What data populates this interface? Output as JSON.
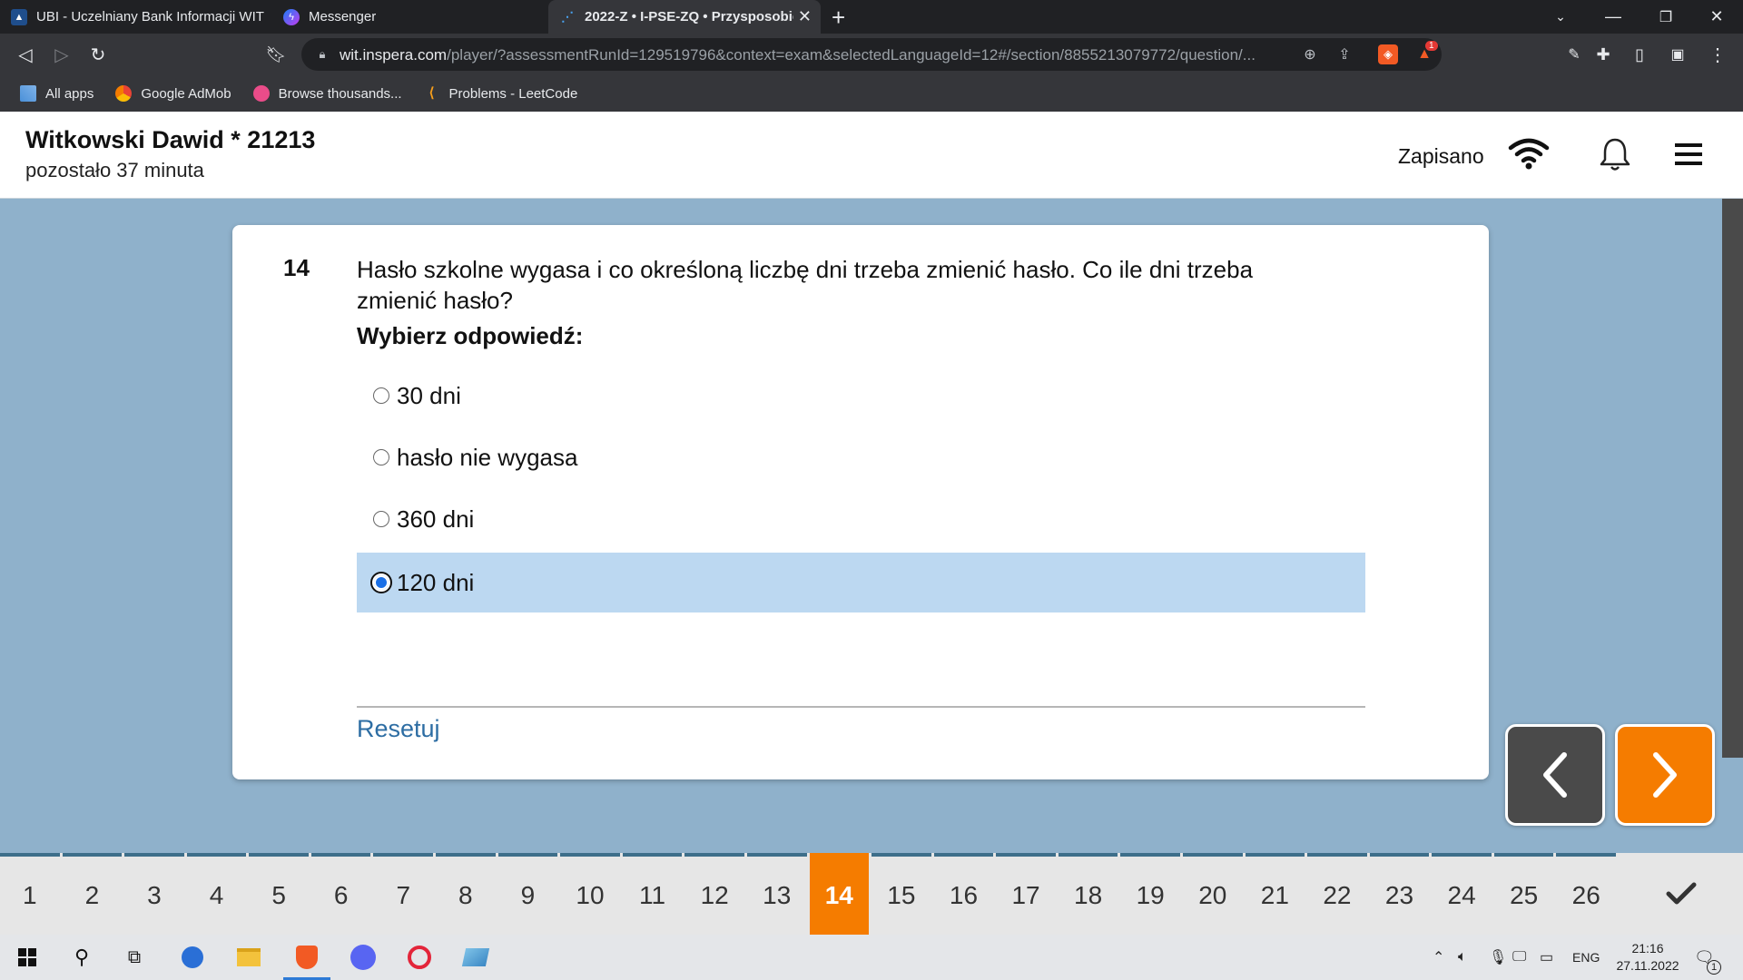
{
  "browser": {
    "tabs": [
      {
        "title": "UBI - Uczelniany Bank Informacji WIT",
        "active": false
      },
      {
        "title": "Messenger",
        "active": false
      },
      {
        "title": "2022-Z • I-PSE-ZQ • Przysposobie",
        "active": true
      }
    ],
    "url_host": "wit.inspera.com",
    "url_path": "/player/?assessmentRunId=129519796&context=exam&selectedLanguageId=12#/section/8855213079772/question/...",
    "bookmarks": [
      "All apps",
      "Google AdMob",
      "Browse thousands...",
      "Problems - LeetCode"
    ],
    "brave_badge": "1"
  },
  "header": {
    "user": "Witkowski Dawid * 21213",
    "time_left": "pozostało 37 minuta",
    "save_status": "Zapisano"
  },
  "question": {
    "number": "14",
    "text": "Hasło szkolne wygasa i co określoną liczbę dni trzeba zmienić hasło. Co ile dni trzeba zmienić hasło?",
    "instruction": "Wybierz odpowiedź:",
    "options": [
      {
        "label": "30 dni",
        "selected": false
      },
      {
        "label": "hasło nie wygasa",
        "selected": false
      },
      {
        "label": "360 dni",
        "selected": false
      },
      {
        "label": "120 dni",
        "selected": true
      }
    ],
    "reset_label": "Resetuj"
  },
  "navigation": {
    "questions": [
      "1",
      "2",
      "3",
      "4",
      "5",
      "6",
      "7",
      "8",
      "9",
      "10",
      "11",
      "12",
      "13",
      "14",
      "15",
      "16",
      "17",
      "18",
      "19",
      "20",
      "21",
      "22",
      "23",
      "24",
      "25",
      "26"
    ],
    "current": "14"
  },
  "colors": {
    "accent_orange": "#f57c00",
    "selected_bg": "#bcd8f1",
    "link_blue": "#2d6da3",
    "page_bg": "#8fb1cb"
  },
  "taskbar": {
    "language": "ENG",
    "time": "21:16",
    "date": "27.11.2022",
    "notification_count": "1"
  }
}
